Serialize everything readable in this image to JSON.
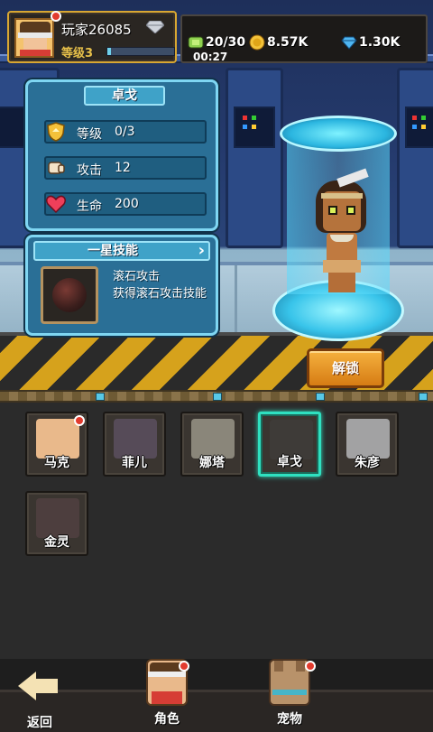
{
  "player": {
    "name": "玩家26085",
    "level": "等级3",
    "exp_fraction": 0.05,
    "has_notification": true
  },
  "resources": {
    "stamina": "20/30",
    "gold": "8.57K",
    "diamonds": "1.30K",
    "timer": "00:27"
  },
  "hero": {
    "name": "卓戈",
    "stats": [
      {
        "icon": "level-shield-icon",
        "label": "等级",
        "value": "0/3"
      },
      {
        "icon": "attack-fist-icon",
        "label": "攻击",
        "value": "12"
      },
      {
        "icon": "heart-icon",
        "label": "生命",
        "value": "200"
      }
    ],
    "skill": {
      "tab_label": "一星技能",
      "name": "滚石攻击",
      "description": "获得滚石攻击技能"
    },
    "unlock_label": "解锁"
  },
  "characters": [
    {
      "name": "马克",
      "owned": true,
      "notify": true,
      "selected": false,
      "color": "#e9b98b"
    },
    {
      "name": "菲儿",
      "owned": false,
      "notify": false,
      "selected": false,
      "color": "#b04ac0"
    },
    {
      "name": "娜塔",
      "owned": false,
      "notify": false,
      "selected": false,
      "color": "#d6b24a"
    },
    {
      "name": "卓戈",
      "owned": false,
      "notify": false,
      "selected": true,
      "color": "#6a4a30"
    },
    {
      "name": "朱彦",
      "owned": false,
      "notify": false,
      "selected": false,
      "color": "#d8d8e0"
    },
    {
      "name": "金灵",
      "owned": false,
      "notify": false,
      "selected": false,
      "color": "#c03a3a"
    }
  ],
  "nav": {
    "back": "返回",
    "roles": "角色",
    "pets": "宠物"
  },
  "colors": {
    "accent_cyan": "#7fd6f2",
    "selected_border": "#2fe0c0",
    "button_orange": "#f5b13e",
    "notify_red": "#e23b2e",
    "gold_border": "#d8a732"
  }
}
